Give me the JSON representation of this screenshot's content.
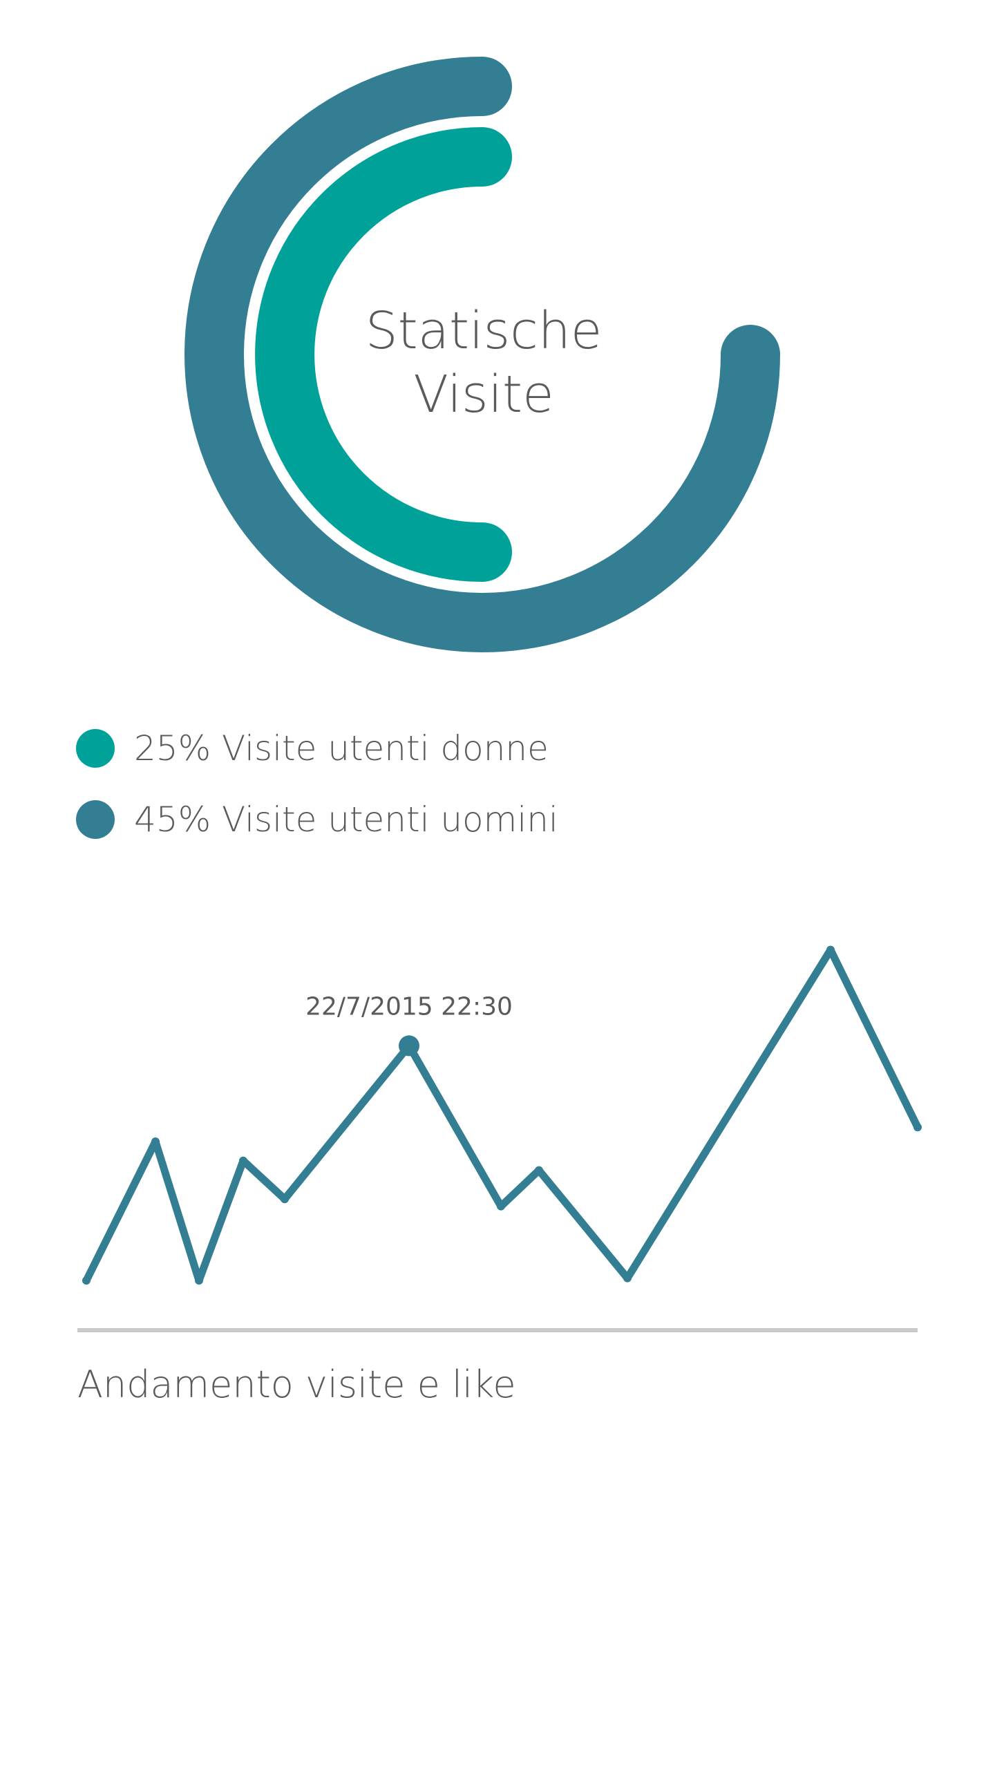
{
  "colors": {
    "women": "#00a199",
    "men": "#337e92",
    "text": "#5a5a5a",
    "baseline": "#c8c8c8"
  },
  "donut": {
    "title_line1": "Statische",
    "title_line2": "Visite"
  },
  "chart_data": [
    {
      "type": "pie",
      "variant": "radial-bar",
      "title": "Statische Visite",
      "series": [
        {
          "name": "Visite utenti donne",
          "percent": 25,
          "label": "25% Visite utenti donne",
          "color": "#00a199"
        },
        {
          "name": "Visite utenti uomini",
          "percent": 45,
          "label": "45% Visite utenti uomini",
          "color": "#337e92"
        }
      ],
      "legend": "bottom-left"
    },
    {
      "type": "line",
      "title": "Andamento visite e like",
      "y": [
        2,
        60,
        2,
        52,
        36,
        100,
        33,
        48,
        3,
        140,
        66
      ],
      "ylim": [
        0,
        150
      ],
      "grid": false,
      "highlight": {
        "index": 5,
        "label": "22/7/2015 22:30"
      }
    }
  ]
}
